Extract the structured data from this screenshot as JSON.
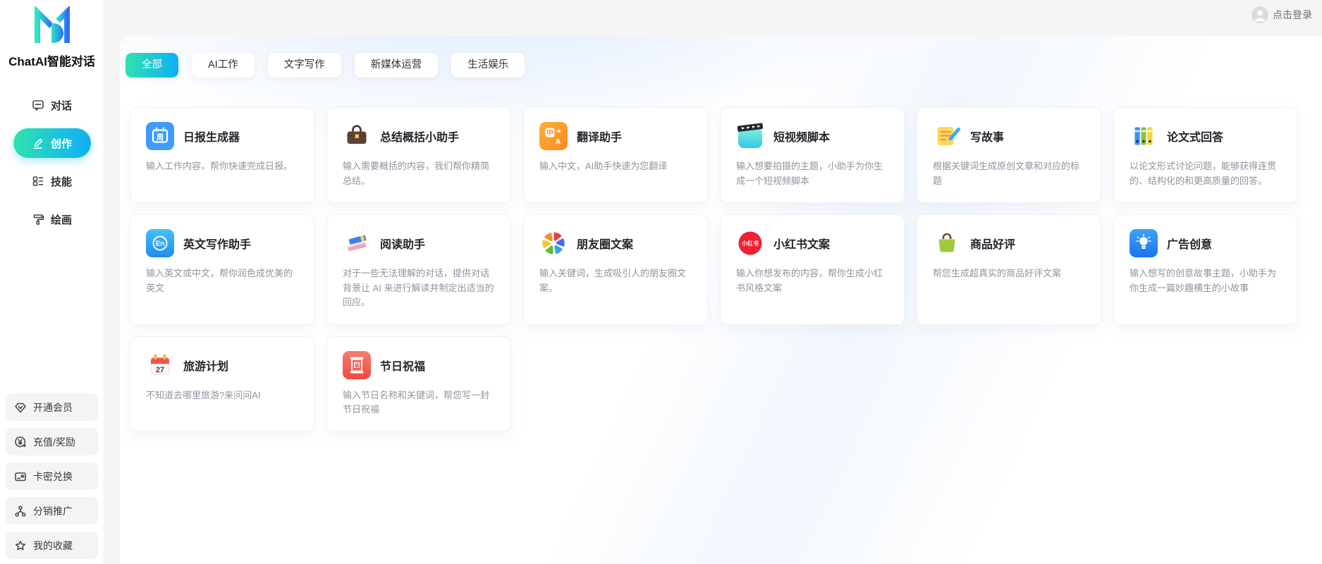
{
  "app": {
    "title": "ChatAI智能对话",
    "login_label": "点击登录"
  },
  "colors": {
    "accent_from": "#2fe3ae",
    "accent_to": "#10aef6",
    "panel_bg": "#ffffff",
    "page_bg": "#f5f6f4"
  },
  "sidebar": {
    "nav": [
      {
        "label": "对话",
        "icon": "chat-icon",
        "active": false
      },
      {
        "label": "创作",
        "icon": "edit-icon",
        "active": true
      },
      {
        "label": "技能",
        "icon": "skills-icon",
        "active": false
      },
      {
        "label": "绘画",
        "icon": "paint-icon",
        "active": false
      }
    ],
    "utilities": [
      {
        "label": "开通会员",
        "icon": "gem-icon"
      },
      {
        "label": "充值/奖励",
        "icon": "coin-yen-icon"
      },
      {
        "label": "卡密兑换",
        "icon": "card-icon"
      },
      {
        "label": "分销推广",
        "icon": "network-icon"
      },
      {
        "label": "我的收藏",
        "icon": "star-icon"
      }
    ]
  },
  "tabs": [
    {
      "label": "全部",
      "active": true
    },
    {
      "label": "AI工作",
      "active": false
    },
    {
      "label": "文字写作",
      "active": false
    },
    {
      "label": "新媒体运营",
      "active": false
    },
    {
      "label": "生活娱乐",
      "active": false
    }
  ],
  "cards": [
    {
      "title": "日报生成器",
      "desc": "输入工作内容，帮你快速完成日报。",
      "icon": "daily-report-icon",
      "icon_text": "周"
    },
    {
      "title": "总结概括小助手",
      "desc": "输入需要概括的内容，我们帮你精简总结。",
      "icon": "briefcase-icon"
    },
    {
      "title": "翻译助手",
      "desc": "输入中文，AI助手快速为您翻译",
      "icon": "translate-icon",
      "icon_text": "中"
    },
    {
      "title": "短视频脚本",
      "desc": "输入想要拍摄的主题，小助手为你生成一个短视频脚本",
      "icon": "clapper-icon"
    },
    {
      "title": "写故事",
      "desc": "根据关键词生成原创文章和对应的标题",
      "icon": "memo-pencil-icon"
    },
    {
      "title": "论文式回答",
      "desc": "以论文形式讨论问题，能够获得连贯的、结构化的和更高质量的回答。",
      "icon": "binders-icon"
    },
    {
      "title": "英文写作助手",
      "desc": "输入英文或中文，帮你润色成优美的英文",
      "icon": "english-icon",
      "icon_text": "En"
    },
    {
      "title": "阅读助手",
      "desc": "对于一些无法理解的对话，提供对话背景让 AI 来进行解读并制定出适当的回应。",
      "icon": "books-icon"
    },
    {
      "title": "朋友圈文案",
      "desc": "输入关键词，生成吸引人的朋友圈文案。",
      "icon": "moments-icon"
    },
    {
      "title": "小红书文案",
      "desc": "输入你想发布的内容，帮你生成小红书风格文案",
      "icon": "xiaohongshu-icon",
      "icon_text": "小红书"
    },
    {
      "title": "商品好评",
      "desc": "帮您生成超真实的商品好评文案",
      "icon": "shopping-bag-icon"
    },
    {
      "title": "广告创意",
      "desc": "输入想写的创意故事主题，小助手为你生成一篇妙趣横生的小故事",
      "icon": "bulb-icon"
    },
    {
      "title": "旅游计划",
      "desc": "不知道去哪里旅游?来问问AI",
      "icon": "calendar-27-icon",
      "icon_text": "27"
    },
    {
      "title": "节日祝福",
      "desc": "输入节日名称和关键词，帮您写一封节日祝福",
      "icon": "festival-icon",
      "icon_text": "福"
    }
  ]
}
